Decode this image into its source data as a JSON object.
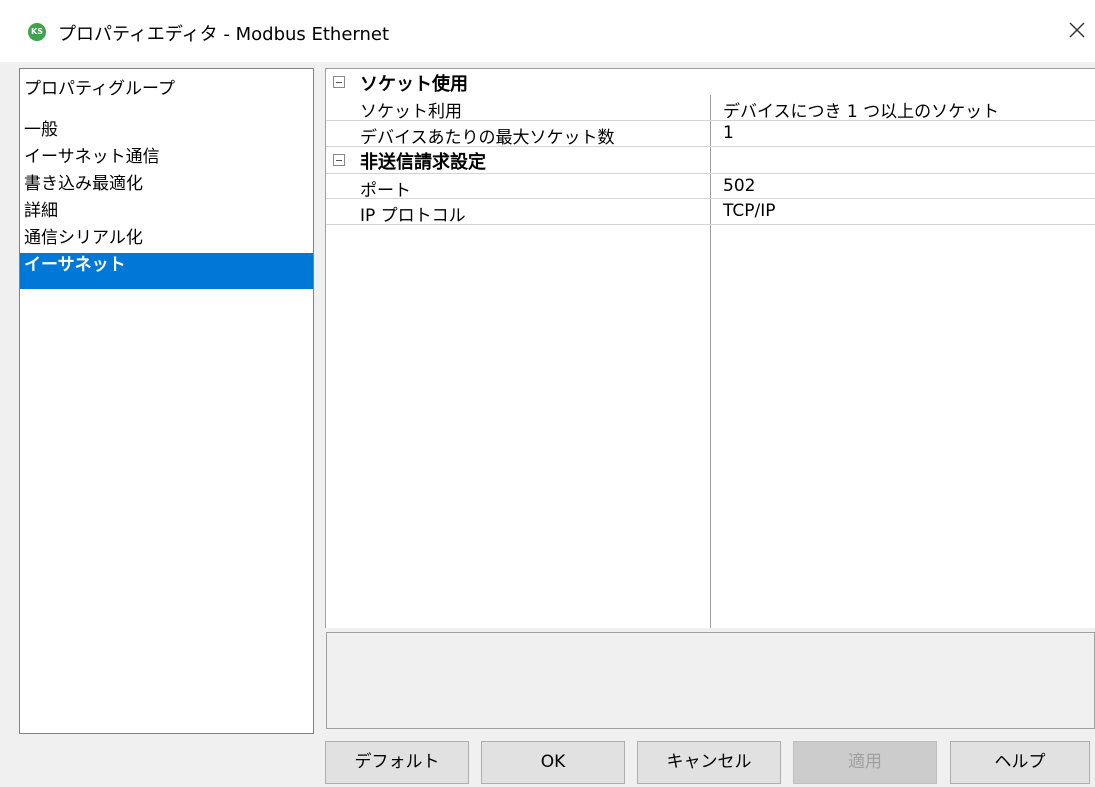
{
  "window": {
    "app_icon_text": "KS",
    "title": "プロパティエディタ - Modbus Ethernet",
    "close_glyph": "×"
  },
  "property_groups": {
    "header": "プロパティグループ",
    "items": [
      {
        "label": "一般",
        "selected": false
      },
      {
        "label": "イーサネット通信",
        "selected": false
      },
      {
        "label": "書き込み最適化",
        "selected": false
      },
      {
        "label": "詳細",
        "selected": false
      },
      {
        "label": "通信シリアル化",
        "selected": false
      },
      {
        "label": "イーサネット",
        "selected": true
      }
    ]
  },
  "grid": {
    "categories": [
      {
        "label": "ソケット使用",
        "collapse_glyph": "⊟",
        "properties": [
          {
            "name": "ソケット利用",
            "value": "デバイスにつき 1 つ以上のソケット"
          },
          {
            "name": "デバイスあたりの最大ソケット数",
            "value": "1"
          }
        ]
      },
      {
        "label": "非送信請求設定",
        "collapse_glyph": "⊟",
        "properties": [
          {
            "name": "ポート",
            "value": "502"
          },
          {
            "name": "IP プロトコル",
            "value": "TCP/IP"
          }
        ]
      }
    ]
  },
  "description": "",
  "buttons": {
    "default_label": "デフォルト",
    "ok_label": "OK",
    "cancel_label": "キャンセル",
    "apply_label": "適用",
    "apply_enabled": false,
    "help_label": "ヘルプ"
  },
  "colors": {
    "selection": "#0078d7",
    "dialog_bg": "#f0f0f0",
    "app_icon": "#3aa54a"
  }
}
